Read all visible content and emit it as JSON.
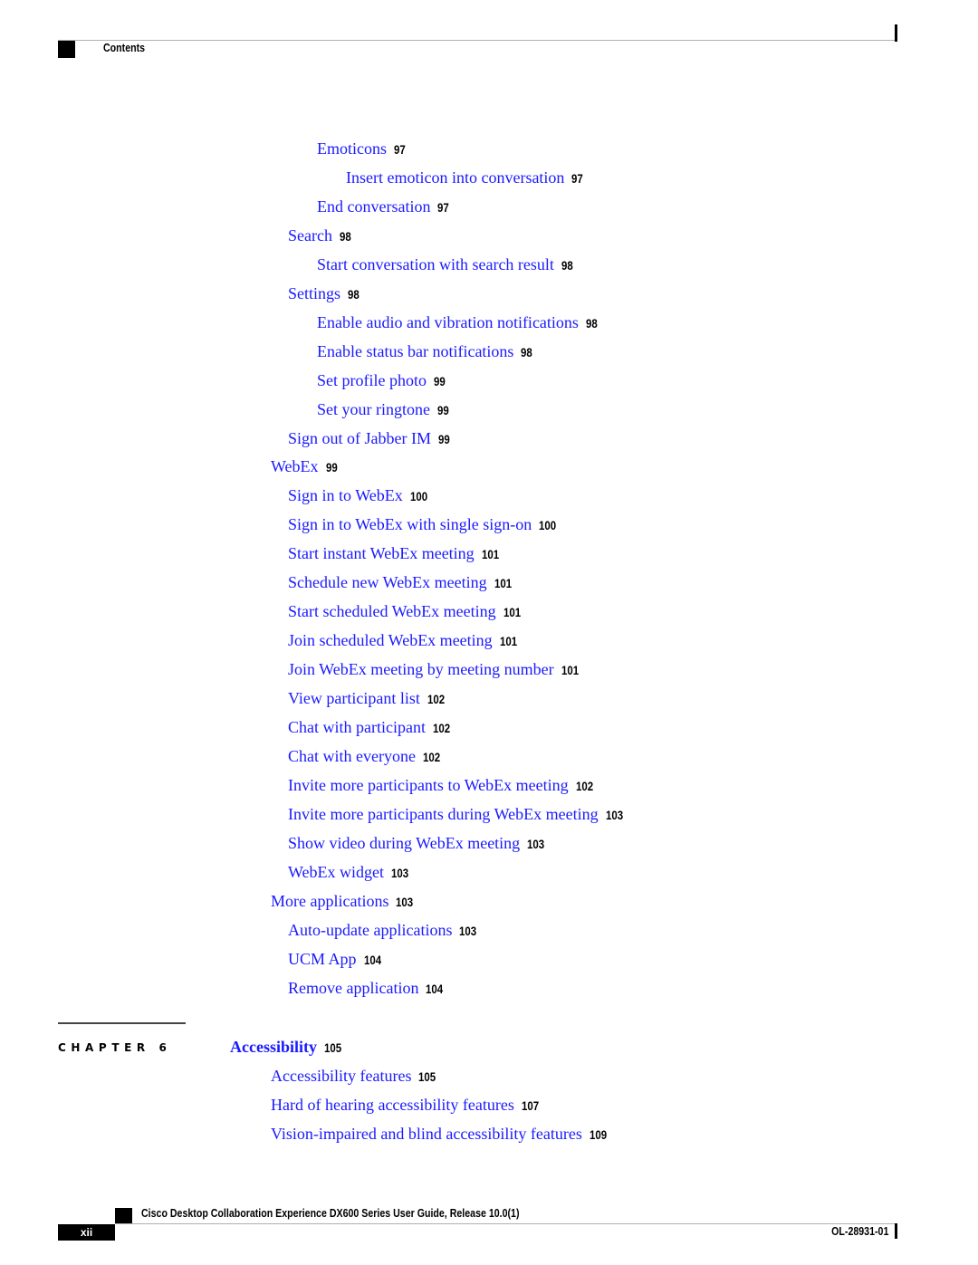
{
  "header": {
    "section_title": "Contents"
  },
  "toc": [
    {
      "title": "Emoticons",
      "page": "97",
      "level": 2
    },
    {
      "title": "Insert emoticon into conversation",
      "page": "97",
      "level": 3
    },
    {
      "title": "End conversation",
      "page": "97",
      "level": 2
    },
    {
      "title": "Search",
      "page": "98",
      "level": 1
    },
    {
      "title": "Start conversation with search result",
      "page": "98",
      "level": 2
    },
    {
      "title": "Settings",
      "page": "98",
      "level": 1
    },
    {
      "title": "Enable audio and vibration notifications",
      "page": "98",
      "level": 2
    },
    {
      "title": "Enable status bar notifications",
      "page": "98",
      "level": 2
    },
    {
      "title": "Set profile photo",
      "page": "99",
      "level": 2
    },
    {
      "title": "Set your ringtone",
      "page": "99",
      "level": 2
    },
    {
      "title": "Sign out of Jabber IM",
      "page": "99",
      "level": 1
    },
    {
      "title": "WebEx",
      "page": "99",
      "level": 0
    },
    {
      "title": "Sign in to WebEx",
      "page": "100",
      "level": 1
    },
    {
      "title": "Sign in to WebEx with single sign-on",
      "page": "100",
      "level": 1
    },
    {
      "title": "Start instant WebEx meeting",
      "page": "101",
      "level": 1
    },
    {
      "title": "Schedule new WebEx meeting",
      "page": "101",
      "level": 1
    },
    {
      "title": "Start scheduled WebEx meeting",
      "page": "101",
      "level": 1
    },
    {
      "title": "Join scheduled WebEx meeting",
      "page": "101",
      "level": 1
    },
    {
      "title": "Join WebEx meeting by meeting number",
      "page": "101",
      "level": 1
    },
    {
      "title": "View participant list",
      "page": "102",
      "level": 1
    },
    {
      "title": "Chat with participant",
      "page": "102",
      "level": 1
    },
    {
      "title": "Chat with everyone",
      "page": "102",
      "level": 1
    },
    {
      "title": "Invite more participants to WebEx meeting",
      "page": "102",
      "level": 1
    },
    {
      "title": "Invite more participants during WebEx meeting",
      "page": "103",
      "level": 1
    },
    {
      "title": "Show video during WebEx meeting",
      "page": "103",
      "level": 1
    },
    {
      "title": "WebEx widget",
      "page": "103",
      "level": 1
    },
    {
      "title": "More applications",
      "page": "103",
      "level": 0
    },
    {
      "title": "Auto-update applications",
      "page": "103",
      "level": 1
    },
    {
      "title": "UCM App",
      "page": "104",
      "level": 1
    },
    {
      "title": "Remove application",
      "page": "104",
      "level": 1
    }
  ],
  "chapter": {
    "label": "CHAPTER 6",
    "title": "Accessibility",
    "page": "105",
    "entries": [
      {
        "title": "Accessibility features",
        "page": "105",
        "level": 0
      },
      {
        "title": "Hard of hearing accessibility features",
        "page": "107",
        "level": 0
      },
      {
        "title": "Vision-impaired and blind accessibility features",
        "page": "109",
        "level": 0
      }
    ]
  },
  "footer": {
    "page_number": "xii",
    "book_title": "Cisco Desktop Collaboration Experience DX600 Series User Guide, Release 10.0(1)",
    "doc_number": "OL-28931-01"
  },
  "colors": {
    "link": "#1a1aff",
    "text": "#000000"
  }
}
